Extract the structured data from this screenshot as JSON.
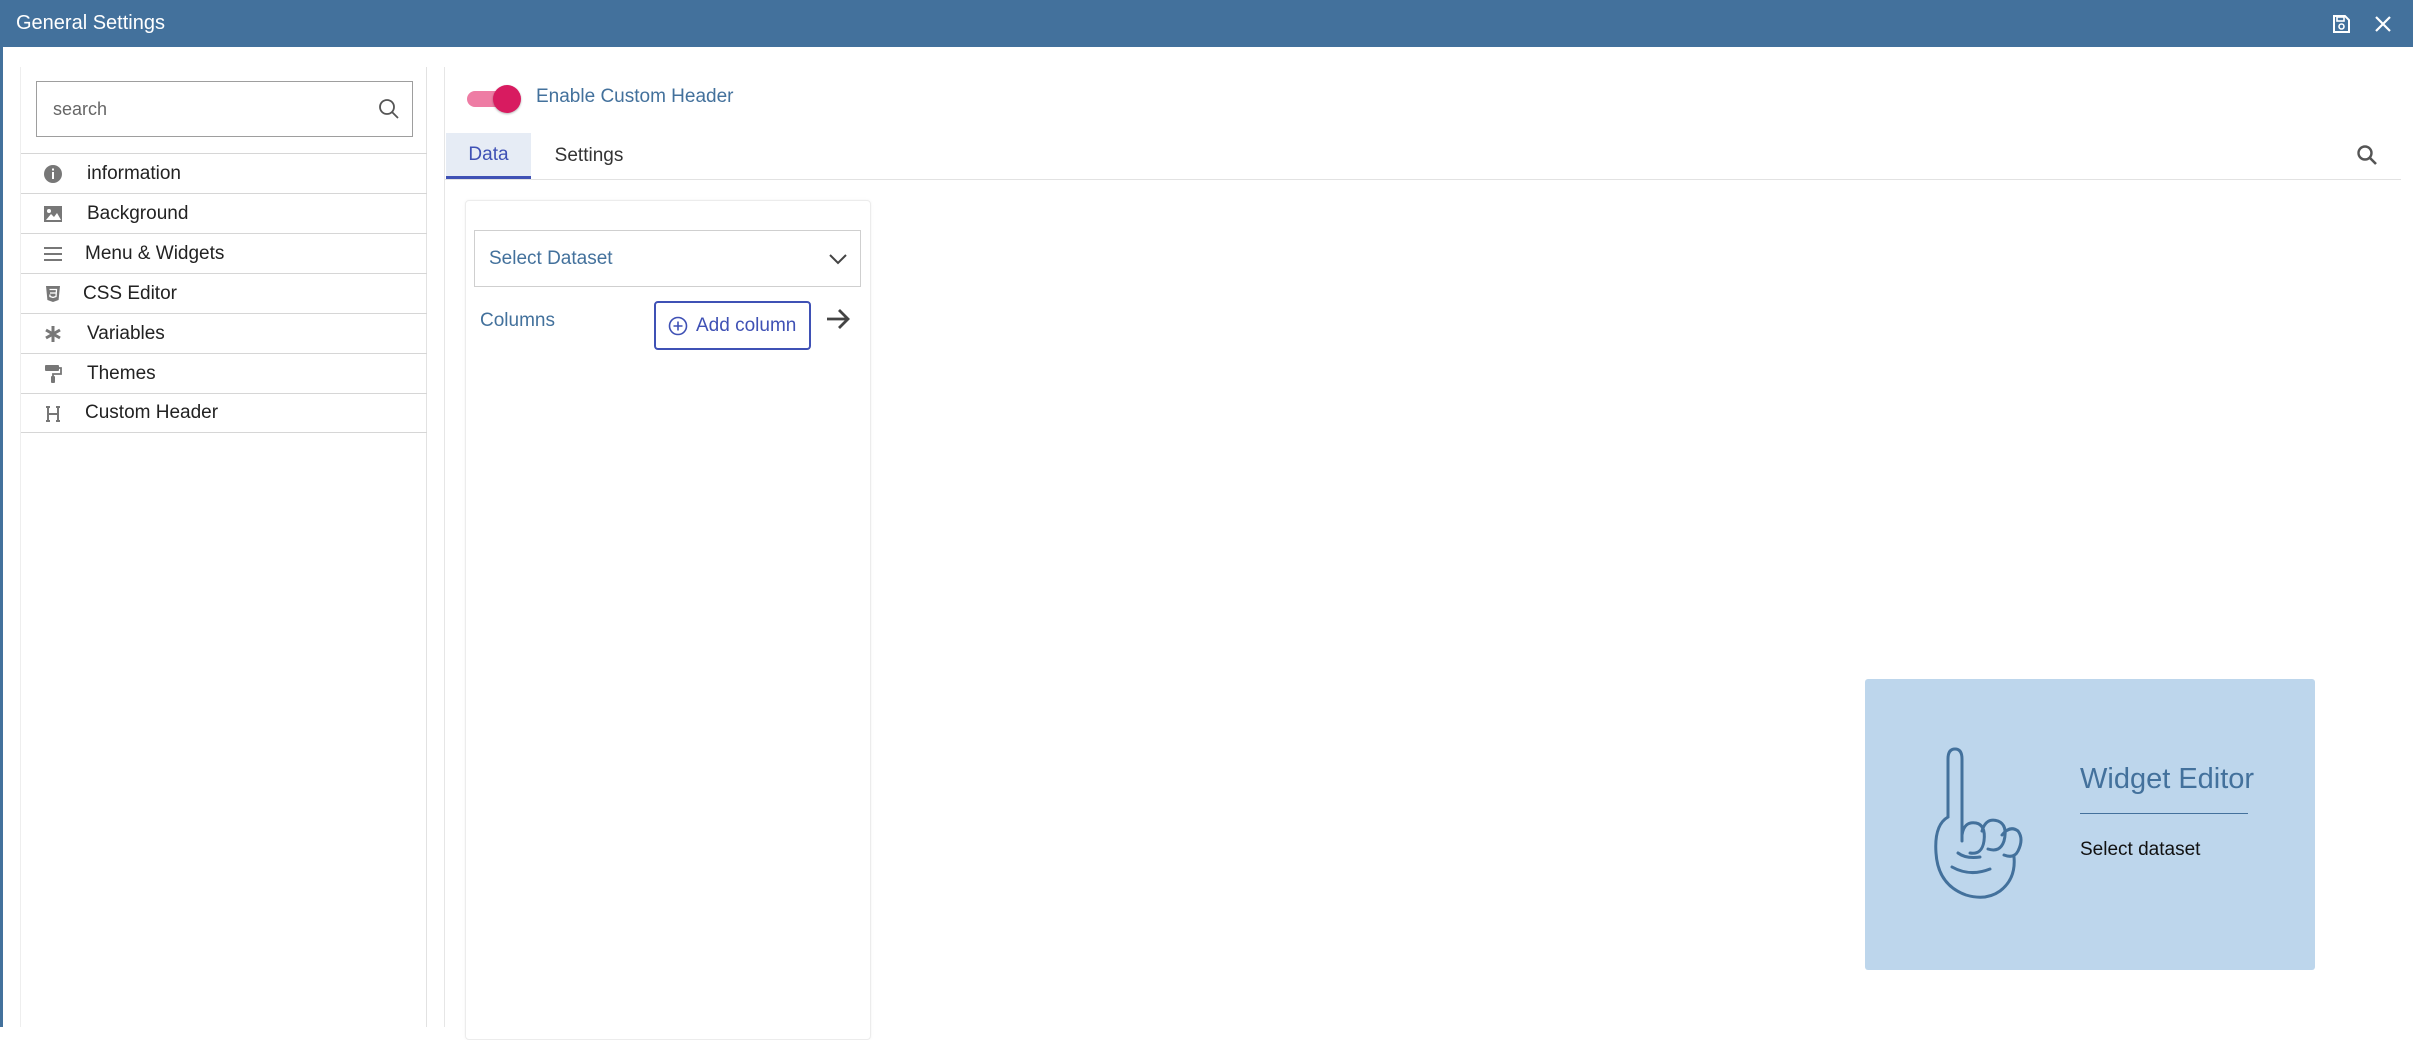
{
  "window": {
    "title": "General Settings"
  },
  "sidebar": {
    "search_placeholder": "search",
    "items": [
      {
        "label": "information",
        "icon": "info-icon"
      },
      {
        "label": "Background",
        "icon": "image-icon"
      },
      {
        "label": "Menu & Widgets",
        "icon": "menu-icon"
      },
      {
        "label": "CSS Editor",
        "icon": "css3-icon"
      },
      {
        "label": "Variables",
        "icon": "asterisk-icon"
      },
      {
        "label": "Themes",
        "icon": "paint-roller-icon"
      },
      {
        "label": "Custom Header",
        "icon": "heading-icon"
      }
    ]
  },
  "main": {
    "toggle_label": "Enable Custom Header",
    "toggle_on": true,
    "tabs": [
      {
        "label": "Data",
        "active": true
      },
      {
        "label": "Settings",
        "active": false
      }
    ],
    "data_panel": {
      "dataset_placeholder": "Select Dataset",
      "columns_label": "Columns",
      "add_column_label": "Add column"
    },
    "placeholder": {
      "title": "Widget Editor",
      "subtitle": "Select dataset"
    }
  },
  "colors": {
    "titlebar": "#43719c",
    "accent": "#3f51b5",
    "toggle": "#d81b60",
    "placeholder_bg": "#bdd6ec"
  }
}
